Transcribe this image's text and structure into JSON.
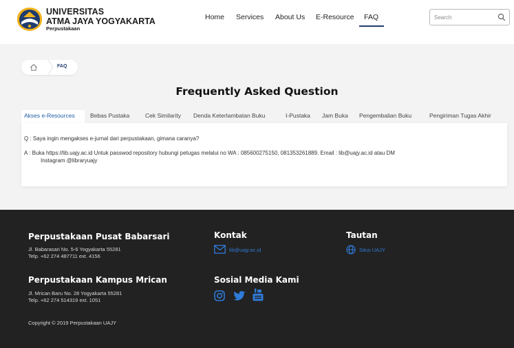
{
  "brand": {
    "line1": "UNIVERSITAS",
    "line2": "ATMA JAYA YOGYAKARTA",
    "line3": "Perpustakaan"
  },
  "nav": {
    "items": [
      {
        "label": "Home"
      },
      {
        "label": "Services"
      },
      {
        "label": "About Us"
      },
      {
        "label": "E-Resource"
      },
      {
        "label": "FAQ",
        "active": true
      }
    ]
  },
  "search": {
    "placeholder": "Search",
    "value": ""
  },
  "breadcrumb": {
    "current": "FAQ"
  },
  "page": {
    "title": "Frequently Asked Question"
  },
  "tabs": [
    {
      "label": "Akses e-Resources",
      "active": true
    },
    {
      "label": "Bebas Pustaka"
    },
    {
      "label": "Cek Similarity"
    },
    {
      "label": "Denda Keterlambatan Buku"
    },
    {
      "label": "I-Pustaka"
    },
    {
      "label": "Jam Buka"
    },
    {
      "label": "Pengembalian Buku"
    },
    {
      "label": "Pengiriman Tugas Akhir"
    }
  ],
  "faq": {
    "question": "Q : Saya ingin mengakses e-jurnal dari perpustakaan, gimana caranya?",
    "answer_line1": "A : Buka https://lib.uajy.ac.id Untuk passwod repository hubungi petugas melalui no WA : 085600275150, 081353261889. Email : lib@uajy.ac.id atau DM",
    "answer_line2": "Instagram @libraryuajy"
  },
  "footer": {
    "babarsari": {
      "title": "Perpustakaan Pusat Babarsari",
      "address": "Jl. Babarasari No. 5-6 Yogyakarta 55281",
      "phone": "Telp. +62 274 487711 ext. 4156"
    },
    "mrican": {
      "title": "Perpustakaan Kampus Mrican",
      "address": "Jl. Mrican Baru No. 28 Yogyakarta 55281",
      "phone": "Telp. +62 274 514319 ext. 1051"
    },
    "copyright": "Copyright © 2019 Perpustakaan UAJY",
    "kontak": {
      "title": "Kontak",
      "email": "lib@uajy.ac.id"
    },
    "sosmed": {
      "title": "Sosial Media Kami"
    },
    "tautan": {
      "title": "Tautan",
      "link": "Situs UAJY"
    }
  },
  "icons": {
    "logo": "uajy-logo",
    "search": "search-icon",
    "home": "home-icon",
    "mail": "mail-icon",
    "globe": "globe-icon",
    "instagram": "instagram-icon",
    "twitter": "twitter-icon",
    "youtube": "youtube-icon"
  },
  "colors": {
    "accent": "#1f3c6e",
    "tab_active": "#1e5fa8",
    "link": "#2f7bd8",
    "footer_bg": "#222222",
    "logo_yellow": "#f2b21b"
  }
}
